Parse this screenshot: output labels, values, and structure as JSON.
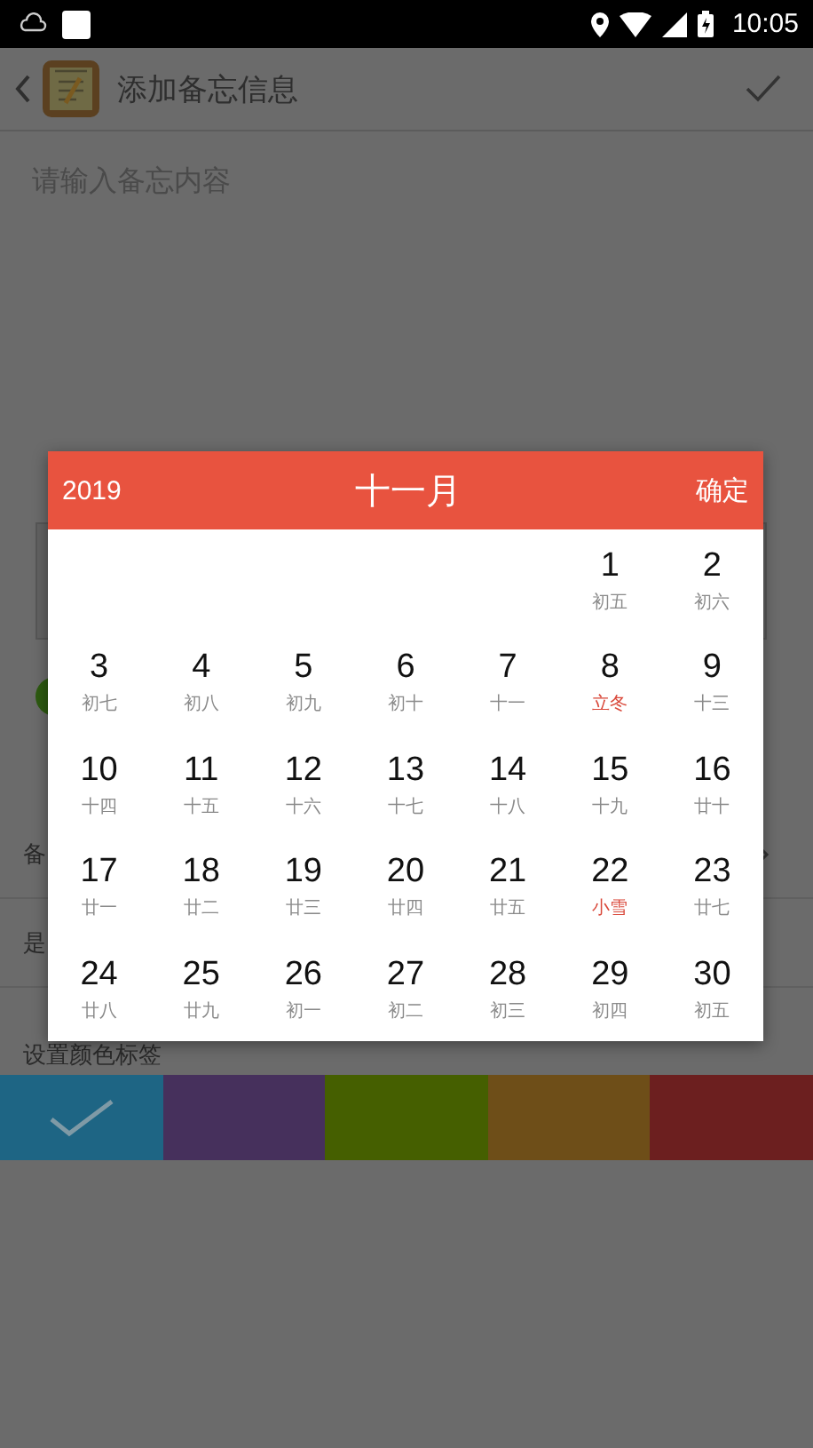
{
  "status_bar": {
    "time": "10:05"
  },
  "header": {
    "title": "添加备忘信息"
  },
  "memo_input": {
    "placeholder": "请输入备忘内容"
  },
  "rows": [
    {
      "label": "备",
      "arrow": true
    },
    {
      "label": "是",
      "arrow": false
    }
  ],
  "color_section": {
    "label": "设置颜色标签"
  },
  "color_swatches": [
    {
      "color": "#1e6584",
      "selected": true
    },
    {
      "color": "#46305c",
      "selected": false
    },
    {
      "color": "#455f00",
      "selected": false
    },
    {
      "color": "#6e4e18",
      "selected": false
    },
    {
      "color": "#6c1f1f",
      "selected": false
    }
  ],
  "date_dialog": {
    "year": "2019",
    "month": "十一月",
    "confirm": "确定",
    "weeks": [
      [
        {
          "day": "1",
          "lunar": "初五",
          "kind": "lunar_day"
        },
        {
          "day": "2",
          "lunar": "初六",
          "kind": "lunar_day"
        }
      ],
      [
        {
          "day": "3",
          "lunar": "初七",
          "kind": "lunar_day"
        },
        {
          "day": "4",
          "lunar": "初八",
          "kind": "lunar_day"
        },
        {
          "day": "5",
          "lunar": "初九",
          "kind": "lunar_day"
        },
        {
          "day": "6",
          "lunar": "初十",
          "kind": "lunar_day"
        },
        {
          "day": "7",
          "lunar": "十一",
          "kind": "lunar_day"
        },
        {
          "day": "8",
          "lunar": "立冬",
          "kind": "solar_term"
        },
        {
          "day": "9",
          "lunar": "十三",
          "kind": "lunar_day"
        }
      ],
      [
        {
          "day": "10",
          "lunar": "十四",
          "kind": "lunar_day"
        },
        {
          "day": "11",
          "lunar": "十五",
          "kind": "lunar_day"
        },
        {
          "day": "12",
          "lunar": "十六",
          "kind": "lunar_day"
        },
        {
          "day": "13",
          "lunar": "十七",
          "kind": "lunar_day"
        },
        {
          "day": "14",
          "lunar": "十八",
          "kind": "lunar_day"
        },
        {
          "day": "15",
          "lunar": "十九",
          "kind": "lunar_day"
        },
        {
          "day": "16",
          "lunar": "廿十",
          "kind": "lunar_day"
        }
      ],
      [
        {
          "day": "17",
          "lunar": "廿一",
          "kind": "lunar_day"
        },
        {
          "day": "18",
          "lunar": "廿二",
          "kind": "lunar_day"
        },
        {
          "day": "19",
          "lunar": "廿三",
          "kind": "lunar_day"
        },
        {
          "day": "20",
          "lunar": "廿四",
          "kind": "lunar_day"
        },
        {
          "day": "21",
          "lunar": "廿五",
          "kind": "lunar_day"
        },
        {
          "day": "22",
          "lunar": "小雪",
          "kind": "solar_term"
        },
        {
          "day": "23",
          "lunar": "廿七",
          "kind": "lunar_day"
        }
      ],
      [
        {
          "day": "24",
          "lunar": "廿八",
          "kind": "lunar_day"
        },
        {
          "day": "25",
          "lunar": "廿九",
          "kind": "lunar_day"
        },
        {
          "day": "26",
          "lunar": "初一",
          "kind": "lunar_day"
        },
        {
          "day": "27",
          "lunar": "初二",
          "kind": "lunar_day"
        },
        {
          "day": "28",
          "lunar": "初三",
          "kind": "lunar_day"
        },
        {
          "day": "29",
          "lunar": "初四",
          "kind": "lunar_day"
        },
        {
          "day": "30",
          "lunar": "初五",
          "kind": "lunar_day"
        }
      ]
    ]
  }
}
